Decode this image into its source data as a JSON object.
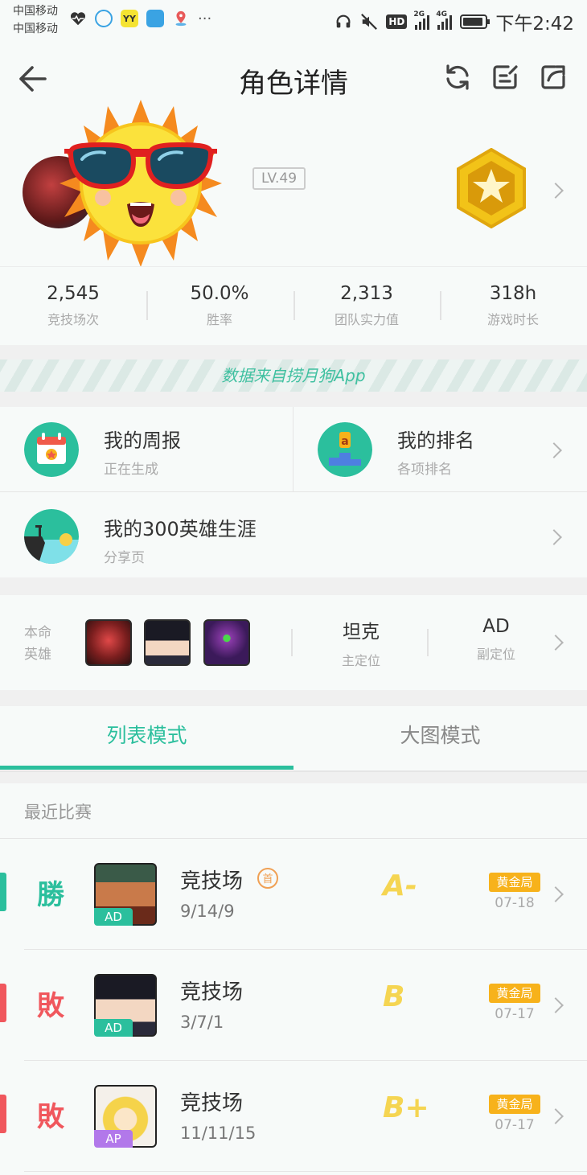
{
  "status_bar": {
    "carrier_1": "中国移动",
    "carrier_2": "中国移动",
    "net_1": "2G",
    "net_2": "4G",
    "hd": "HD",
    "time": "下午2:42",
    "notification_icons": [
      "heartbeat-icon",
      "qq-icon",
      "yy-icon",
      "chat-icon",
      "map-pin-icon",
      "more-icon"
    ]
  },
  "nav": {
    "title": "角色详情",
    "icons": [
      "back-arrow-icon",
      "refresh-icon",
      "edit-icon",
      "share-icon"
    ]
  },
  "profile": {
    "level": "LV.49",
    "medal_color": "#f2c318",
    "stats": [
      {
        "value": "2,545",
        "label": "竞技场次"
      },
      {
        "value": "50.0%",
        "label": "胜率"
      },
      {
        "value": "2,313",
        "label": "团队实力值"
      },
      {
        "value": "318h",
        "label": "游戏时长"
      }
    ]
  },
  "banner": {
    "text": "数据来自捞月狗App"
  },
  "features": [
    {
      "title": "我的周报",
      "subtitle": "正在生成",
      "icon": "calendar-icon"
    },
    {
      "title": "我的排名",
      "subtitle": "各项排名",
      "icon": "podium-icon"
    },
    {
      "title": "我的300英雄生涯",
      "subtitle": "分享页",
      "icon": "sunset-icon"
    }
  ],
  "heroes": {
    "label_line1": "本命",
    "label_line2": "英雄",
    "primary_position": {
      "value": "坦克",
      "label": "主定位"
    },
    "secondary_position": {
      "value": "AD",
      "label": "副定位"
    }
  },
  "tabs": {
    "list_mode": "列表模式",
    "image_mode": "大图模式",
    "active": "list_mode"
  },
  "matches": {
    "section_title": "最近比赛",
    "items": [
      {
        "result": "勝",
        "result_color": "#2bbf9d",
        "mode": "竞技场",
        "first_badge": "首",
        "kda": "9/14/9",
        "role": "AD",
        "role_color": "#2bbf9d",
        "grade": "A-",
        "tier": "黄金局",
        "date": "07-18"
      },
      {
        "result": "敗",
        "result_color": "#f0575d",
        "mode": "竞技场",
        "kda": "3/7/1",
        "role": "AD",
        "role_color": "#2bbf9d",
        "grade": "B",
        "tier": "黄金局",
        "date": "07-17"
      },
      {
        "result": "敗",
        "result_color": "#f0575d",
        "mode": "竞技场",
        "kda": "11/11/15",
        "role": "AP",
        "role_color": "#b278ea",
        "grade": "B+",
        "tier": "黄金局",
        "date": "07-17"
      }
    ]
  },
  "colors": {
    "accent": "#2bbf9d",
    "win": "#2bbf9d",
    "loss": "#f0575d",
    "gold_tier": "#f7b21b"
  }
}
